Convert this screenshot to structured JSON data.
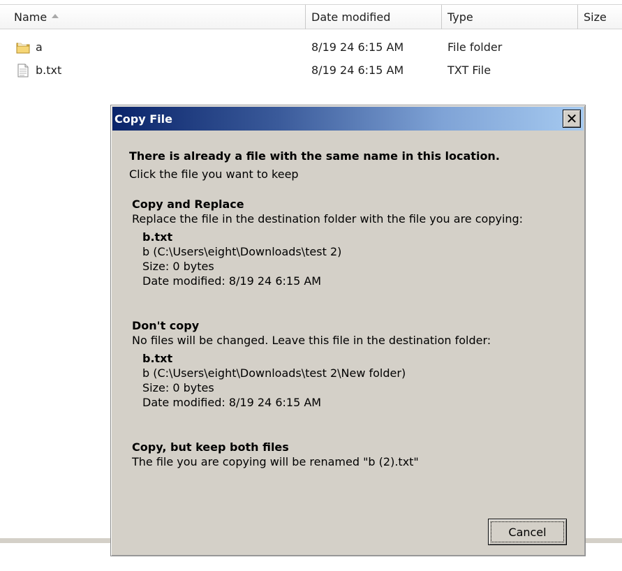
{
  "columns": {
    "name": "Name",
    "date": "Date modified",
    "type": "Type",
    "size": "Size"
  },
  "files": [
    {
      "name": "a",
      "date": "8/19 24 6:15 AM",
      "type": "File folder",
      "icon": "folder-icon"
    },
    {
      "name": "b.txt",
      "date": "8/19 24 6:15 AM",
      "type": "TXT File",
      "icon": "text-file-icon"
    }
  ],
  "dialog": {
    "title": "Copy File",
    "close_label": "✕",
    "heading": "There is already a file with the same name in this location.",
    "subheading": "Click the file you want to keep",
    "replace": {
      "title": "Copy and Replace",
      "description": "Replace the file in the destination folder with the file you are copying:",
      "file_name": "b.txt",
      "path": "b (C:\\Users\\eight\\Downloads\\test 2)",
      "size": "Size: 0 bytes",
      "date": "Date modified: 8/19 24 6:15 AM"
    },
    "dont_copy": {
      "title": "Don't copy",
      "description": "No files will be changed. Leave this file in the destination folder:",
      "file_name": "b.txt",
      "path": "b (C:\\Users\\eight\\Downloads\\test 2\\New folder)",
      "size": "Size: 0 bytes",
      "date": "Date modified: 8/19 24 6:15 AM"
    },
    "keep_both": {
      "title": "Copy, but keep both files",
      "description": "The file you are copying will be renamed \"b (2).txt\""
    },
    "cancel_label": "Cancel"
  }
}
